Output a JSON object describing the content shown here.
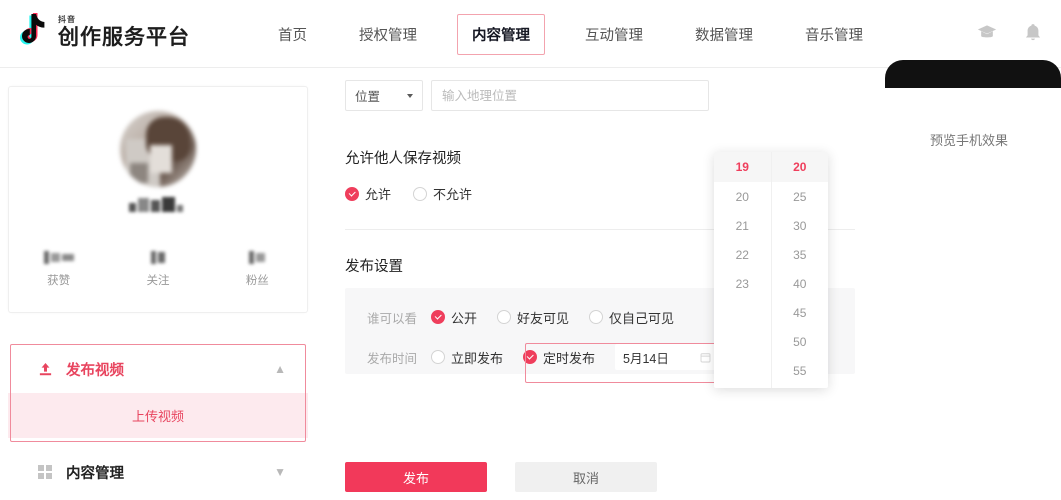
{
  "header": {
    "brand_sub": "抖音",
    "brand_main": "创作服务平台",
    "nav": [
      {
        "label": "首页",
        "active": false
      },
      {
        "label": "授权管理",
        "active": false
      },
      {
        "label": "内容管理",
        "active": true
      },
      {
        "label": "互动管理",
        "active": false
      },
      {
        "label": "数据管理",
        "active": false
      },
      {
        "label": "音乐管理",
        "active": false
      }
    ],
    "icons": [
      {
        "name": "graduation-cap-icon"
      },
      {
        "name": "bell-icon"
      }
    ]
  },
  "sidebar": {
    "stats": [
      {
        "label": "获赞",
        "value": ""
      },
      {
        "label": "关注",
        "value": ""
      },
      {
        "label": "粉丝",
        "value": ""
      }
    ],
    "menu": {
      "publish_label": "发布视频",
      "publish_sub_label": "上传视频",
      "content_label": "内容管理"
    }
  },
  "main": {
    "location": {
      "select_label": "位置",
      "input_placeholder": "输入地理位置",
      "input_value": ""
    },
    "save_section": {
      "title": "允许他人保存视频",
      "options": [
        {
          "label": "允许",
          "checked": true
        },
        {
          "label": "不允许",
          "checked": false
        }
      ]
    },
    "publish_section": {
      "title": "发布设置",
      "visibility": {
        "label": "谁可以看",
        "options": [
          {
            "label": "公开",
            "checked": true
          },
          {
            "label": "好友可见",
            "checked": false
          },
          {
            "label": "仅自己可见",
            "checked": false
          }
        ]
      },
      "timing": {
        "label": "发布时间",
        "options": [
          {
            "label": "立即发布",
            "checked": false
          },
          {
            "label": "定时发布",
            "checked": true
          }
        ],
        "date_value": "5月14日"
      }
    },
    "actions": {
      "publish_label": "发布",
      "cancel_label": "取消"
    }
  },
  "time_picker": {
    "hours": {
      "selected": "19",
      "items": [
        "20",
        "21",
        "22",
        "23"
      ]
    },
    "minutes": {
      "selected": "20",
      "items": [
        "25",
        "30",
        "35",
        "40",
        "45",
        "50",
        "55"
      ]
    }
  },
  "preview": {
    "label": "预览手机效果"
  },
  "colors": {
    "accent": "#ef3e5c",
    "publish_button": "#f2395a",
    "highlight_border": "#f08b9c",
    "sub_menu_bg": "#fdeaee"
  }
}
